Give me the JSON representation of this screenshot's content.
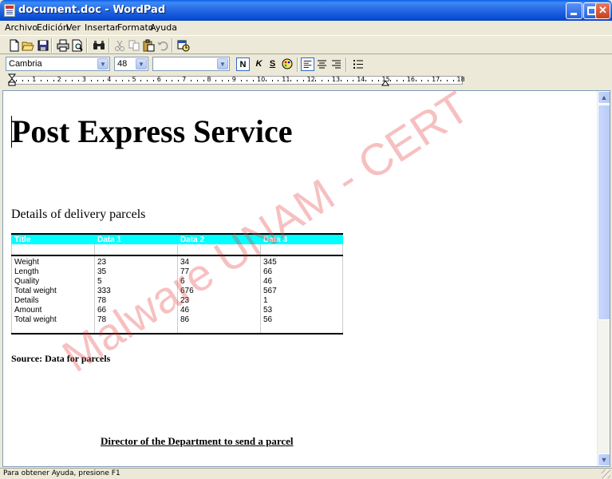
{
  "window": {
    "title": "document.doc - WordPad",
    "minimize_icon": "minimize-icon",
    "maximize_icon": "maximize-icon",
    "close_icon": "close-icon"
  },
  "menu": [
    "Archivo",
    "Edición",
    "Ver",
    "Insertar",
    "Formato",
    "Ayuda"
  ],
  "toolbar": {
    "icons": [
      "new-document-icon",
      "open-icon",
      "save-icon",
      "print-icon",
      "print-preview-icon",
      "find-icon",
      "cut-icon",
      "copy-icon",
      "paste-icon",
      "undo-icon",
      "insert-date-icon"
    ]
  },
  "format": {
    "font_family": "Cambria",
    "font_size": "48",
    "script": "",
    "bold_label": "N",
    "italic_label": "K",
    "underline_label": "S"
  },
  "ruler": {
    "numbers": [
      "1",
      "2",
      "3",
      "4",
      "5",
      "6",
      "7",
      "8",
      "9",
      "10",
      "11",
      "12",
      "13",
      "14",
      "15",
      "16",
      "17",
      "18"
    ]
  },
  "document": {
    "title": "Post Express Service",
    "subtitle": "Details of delivery parcels",
    "table": {
      "headers": [
        "Title",
        "Data 1",
        "Data 2",
        "Data 3"
      ],
      "rows": [
        [
          "Weight",
          "23",
          "34",
          "345"
        ],
        [
          "Length",
          "35",
          "77",
          "66"
        ],
        [
          "Quality",
          "5",
          "6",
          "46"
        ],
        [
          "Total weight",
          "333",
          "676",
          "567"
        ],
        [
          "Details",
          "78",
          "23",
          "1"
        ],
        [
          "Amount",
          "66",
          "46",
          "53"
        ],
        [
          "Total weight",
          "78",
          "86",
          "56"
        ]
      ]
    },
    "source": "Source: Data for parcels",
    "director": "Director of the Department to send a parcel",
    "watermark": "Malware UNAM - CERT"
  },
  "status": {
    "text": "Para obtener Ayuda, presione F1"
  },
  "colors": {
    "title_bar": "#0b4fd6",
    "table_header": "#00ffff",
    "watermark": "#e63c3c"
  }
}
